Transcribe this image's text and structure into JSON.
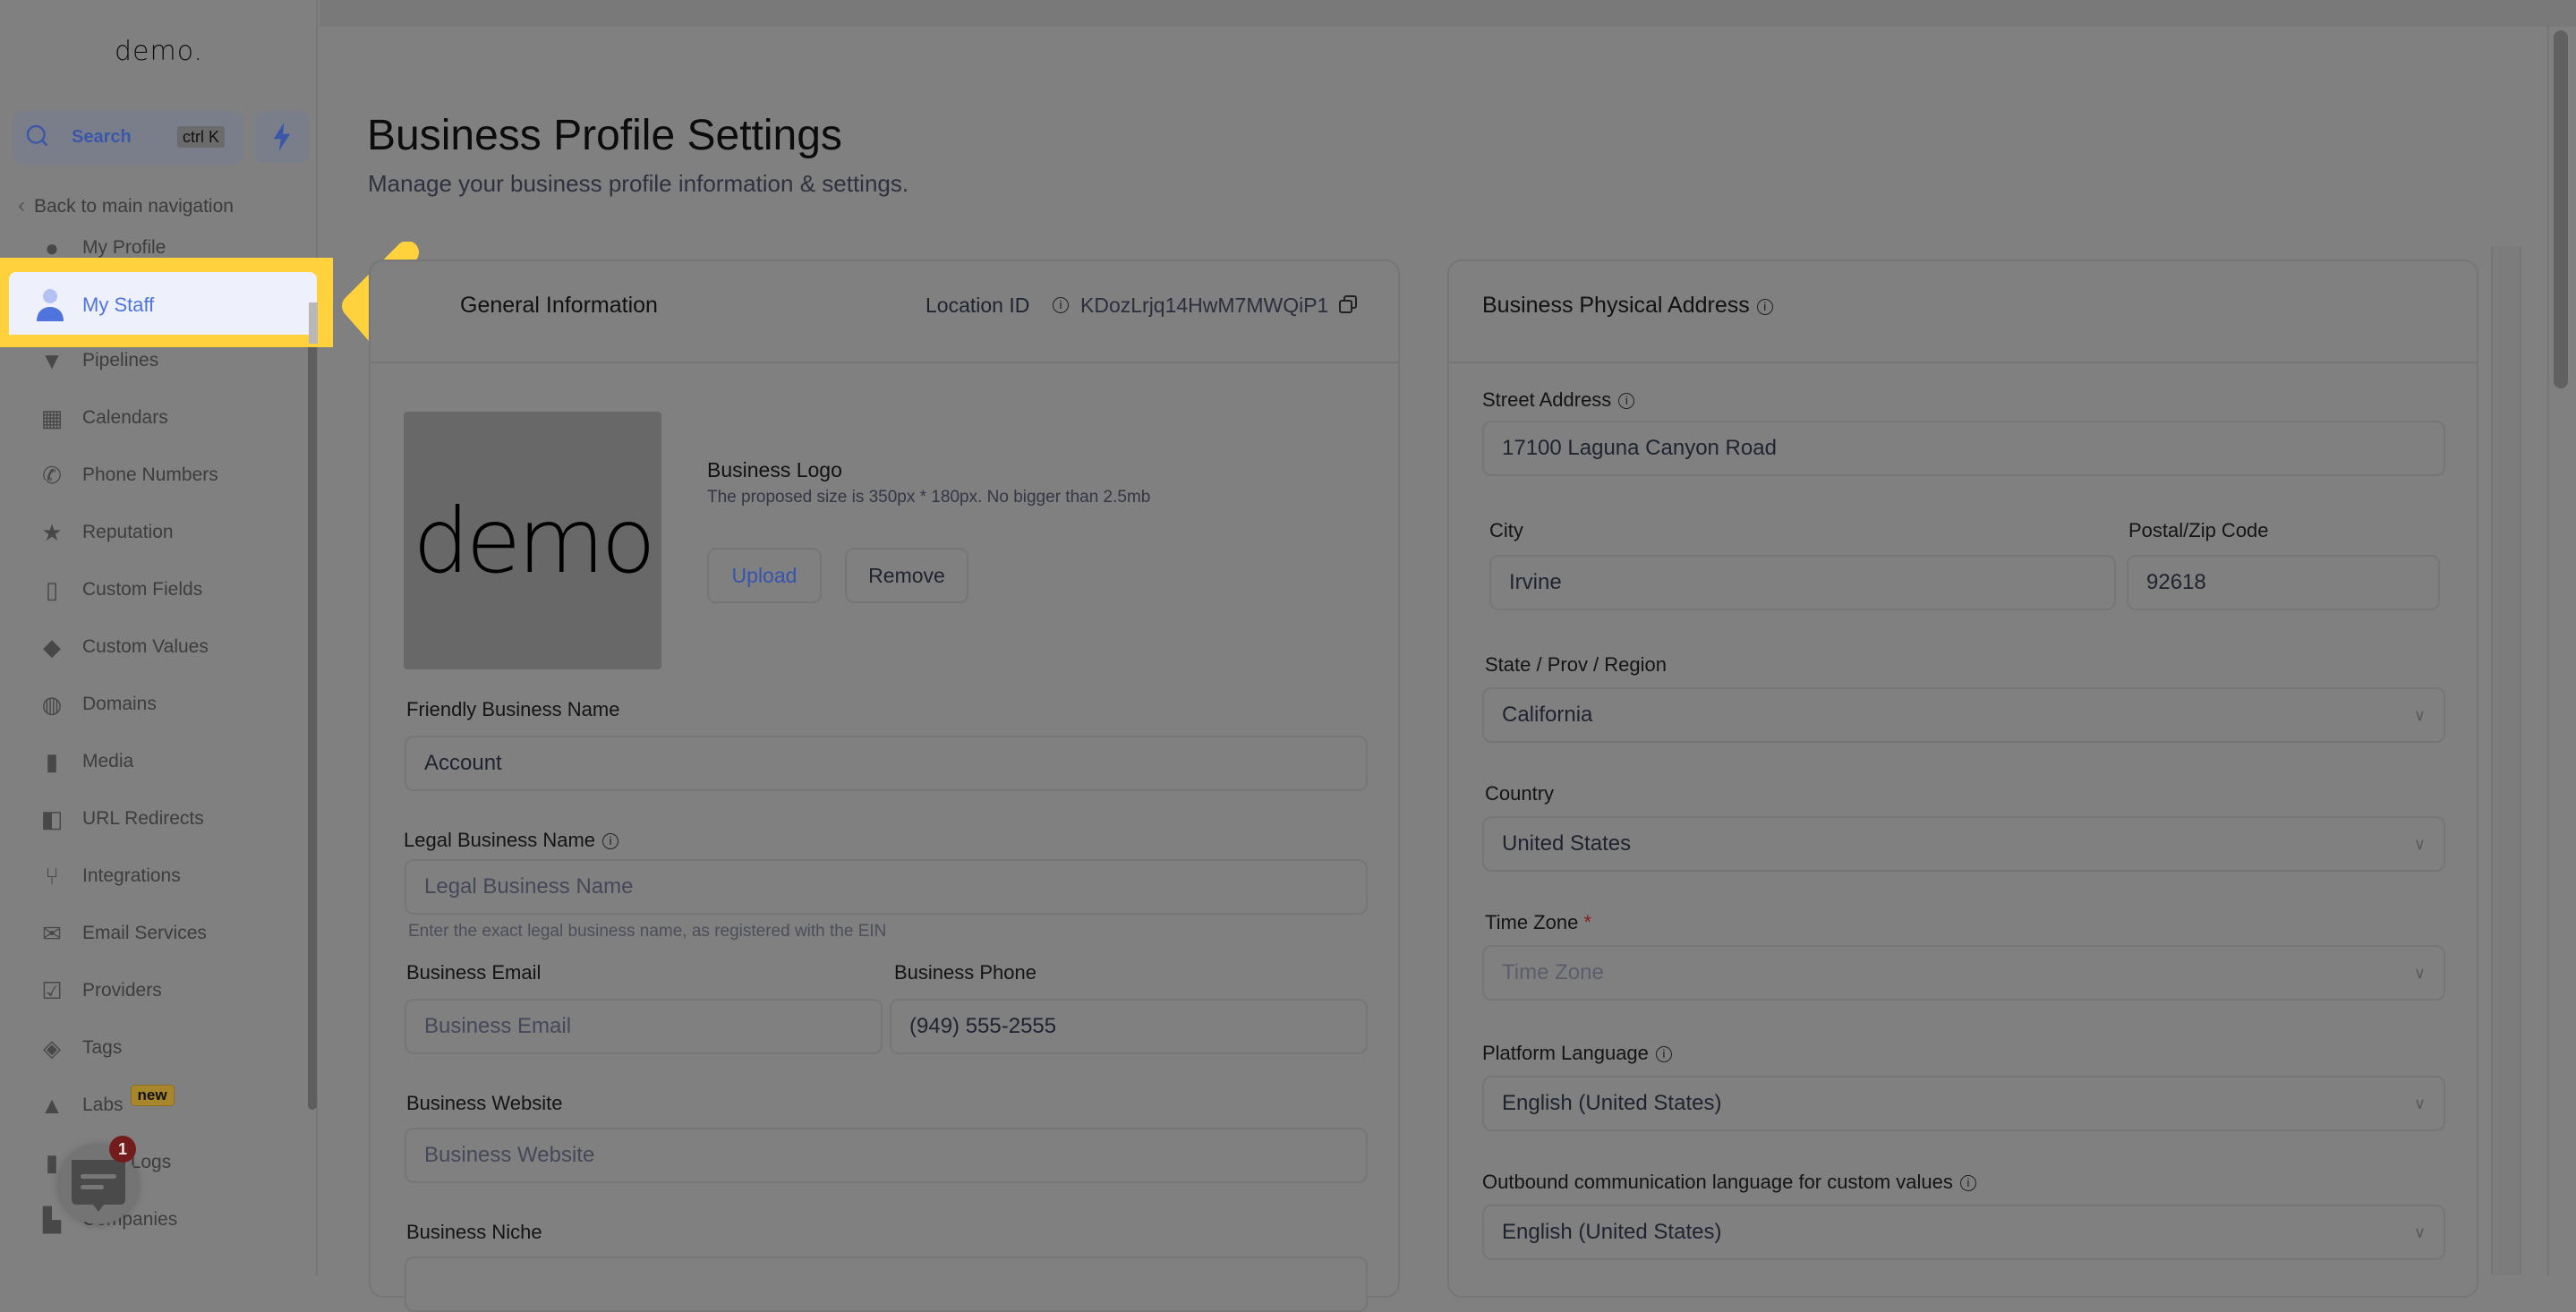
{
  "sidebar": {
    "logo": "demo.",
    "search": {
      "label": "Search",
      "shortcut": "ctrl K"
    },
    "back_label": "Back to main navigation",
    "items": [
      {
        "label": "My Profile",
        "icon": "user-circle-icon"
      },
      {
        "label": "My Staff",
        "icon": "user-icon",
        "active": true
      },
      {
        "label": "Pipelines",
        "icon": "funnel-icon"
      },
      {
        "label": "Calendars",
        "icon": "calendar-icon"
      },
      {
        "label": "Phone Numbers",
        "icon": "phone-icon"
      },
      {
        "label": "Reputation",
        "icon": "star-icon"
      },
      {
        "label": "Custom Fields",
        "icon": "text-field-icon"
      },
      {
        "label": "Custom Values",
        "icon": "gem-icon"
      },
      {
        "label": "Domains",
        "icon": "globe-icon"
      },
      {
        "label": "Media",
        "icon": "video-icon"
      },
      {
        "label": "URL Redirects",
        "icon": "redirect-icon"
      },
      {
        "label": "Integrations",
        "icon": "branch-icon"
      },
      {
        "label": "Email Services",
        "icon": "mail-icon"
      },
      {
        "label": "Providers",
        "icon": "clipboard-check-icon"
      },
      {
        "label": "Tags",
        "icon": "tag-icon"
      },
      {
        "label": "Labs",
        "icon": "flask-icon",
        "badge": "new"
      },
      {
        "label": "Audit Logs",
        "icon": "chart-icon"
      },
      {
        "label": "Companies",
        "icon": "building-icon"
      }
    ],
    "chat_badge": "1"
  },
  "header": {
    "title": "Business Profile Settings",
    "subtitle": "Manage your business profile information & settings."
  },
  "business_info": {
    "title": "General Information",
    "location_id_label": "Location ID",
    "location_id": "KDozLrjq14HwM7MWQiP1",
    "logo": {
      "label": "Business Logo",
      "hint": "The proposed size is 350px * 180px. No bigger than 2.5mb",
      "image_text": "demo",
      "upload": "Upload",
      "remove": "Remove"
    },
    "friendly_name": {
      "label": "Friendly Business Name",
      "value": "Account"
    },
    "legal_name": {
      "label": "Legal Business Name",
      "placeholder": "Legal Business Name",
      "helper": "Enter the exact legal business name, as registered with the EIN"
    },
    "email": {
      "label": "Business Email",
      "placeholder": "Business Email"
    },
    "phone": {
      "label": "Business Phone",
      "value": "(949) 555-2555"
    },
    "website": {
      "label": "Business Website",
      "placeholder": "Business Website"
    },
    "niche": {
      "label": "Business Niche"
    }
  },
  "address": {
    "title": "Business Physical Address",
    "street": {
      "label": "Street Address",
      "value": "17100 Laguna Canyon Road"
    },
    "city": {
      "label": "City",
      "value": "Irvine"
    },
    "zip": {
      "label": "Postal/Zip Code",
      "value": "92618"
    },
    "state": {
      "label": "State / Prov / Region",
      "value": "California"
    },
    "country": {
      "label": "Country",
      "value": "United States"
    },
    "timezone": {
      "label": "Time Zone",
      "required_mark": "*",
      "placeholder": "Time Zone"
    },
    "platform_language": {
      "label": "Platform Language",
      "value": "English (United States)"
    },
    "outbound_language": {
      "label": "Outbound communication language for custom values",
      "value": "English (United States)"
    }
  },
  "annotation": {
    "highlight_color": "#FFD13D",
    "target": "My Staff"
  }
}
